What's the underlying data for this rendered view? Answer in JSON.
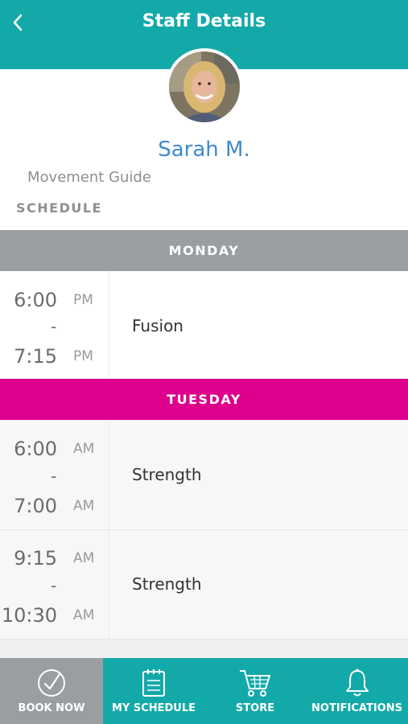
{
  "header": {
    "title": "Staff Details",
    "back_icon": "chevron-left-icon"
  },
  "staff": {
    "name": "Sarah M.",
    "role": "Movement Guide",
    "avatar_icon": "avatar"
  },
  "schedule_label": "SCHEDULE",
  "days": [
    {
      "name": "MONDAY",
      "color": "#989ea1",
      "classes": [
        {
          "start": "6:00",
          "start_ampm": "PM",
          "end": "7:15",
          "end_ampm": "PM",
          "dash": "-",
          "name": "Fusion"
        }
      ]
    },
    {
      "name": "TUESDAY",
      "color": "#dd008c",
      "classes": [
        {
          "start": "6:00",
          "start_ampm": "AM",
          "end": "7:00",
          "end_ampm": "AM",
          "dash": "-",
          "name": "Strength"
        },
        {
          "start": "9:15",
          "start_ampm": "AM",
          "end": "10:30",
          "end_ampm": "AM",
          "dash": "-",
          "name": "Strength"
        }
      ]
    }
  ],
  "bottom_nav": [
    {
      "label": "BOOK NOW",
      "icon": "check-circle-icon",
      "active": true
    },
    {
      "label": "MY SCHEDULE",
      "icon": "calendar-icon",
      "active": false
    },
    {
      "label": "STORE",
      "icon": "cart-icon",
      "active": false
    },
    {
      "label": "NOTIFICATIONS",
      "icon": "bell-icon",
      "active": false
    }
  ],
  "colors": {
    "primary": "#14a9a9",
    "name": "#3f8ad0",
    "nav_active": "#9a9ea1"
  }
}
